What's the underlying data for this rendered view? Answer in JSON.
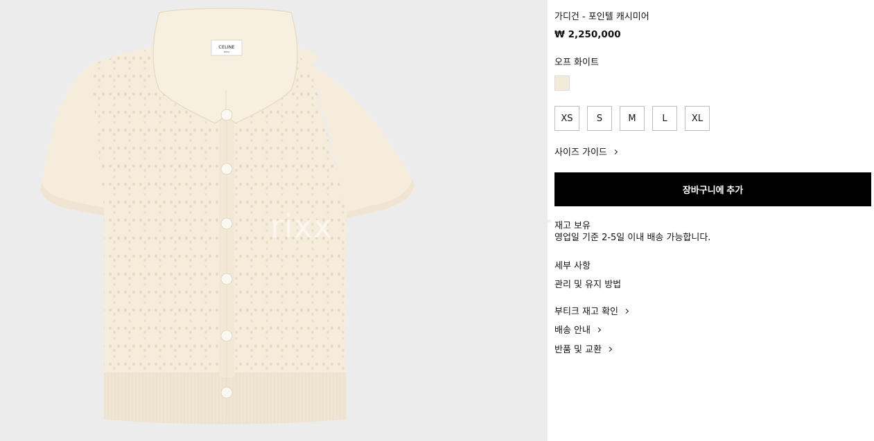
{
  "product": {
    "brand_label": "CELINE",
    "brand_sub": "PARIS",
    "title": "가디건 - 포인텔 캐시미어",
    "price": "₩ 2,250,000",
    "color_name": "오프 화이트",
    "swatch_color": "#f3ead9",
    "garment_color": "#f5ecdb",
    "sizes": [
      "XS",
      "S",
      "M",
      "L",
      "XL"
    ],
    "size_guide_label": "사이즈 가이드",
    "add_to_cart_label": "장바구니에 추가",
    "stock_status": "재고 보유",
    "shipping_note": "영업일 기준 2-5일 이내 배송 가능합니다.",
    "details_label": "세부 사항",
    "care_label": "관리 및 유지 방법",
    "links": [
      "부티크 재고 확인",
      "배송 안내",
      "반품 및 교환"
    ]
  },
  "watermark": {
    "left": "rixx",
    "right": "r"
  }
}
